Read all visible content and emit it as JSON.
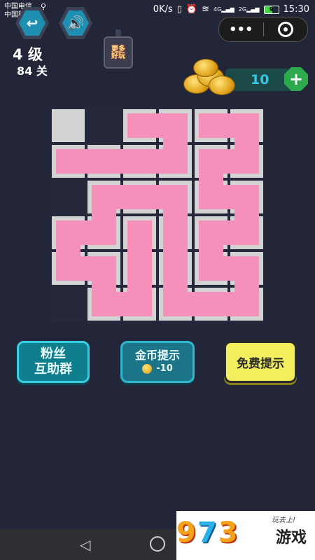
{
  "status_bar": {
    "carrier_1": "中国电信",
    "carrier_2": "中国移动",
    "network_speed": "0K/s",
    "signal_1_label": "4G",
    "signal_2_label": "2G",
    "battery_level": "9",
    "time": "15:30"
  },
  "header": {
    "back_icon": "back-arrow-icon",
    "sound_icon": "speaker-icon",
    "level_label": "4 级",
    "stage_label": "84 关",
    "promo_text_1": "更多",
    "promo_text_2": "好玩",
    "coin_count": "10",
    "menu_dots": "•••"
  },
  "board": {
    "rows": 6,
    "cols": 6,
    "path_color": "#f590bb",
    "cell_color": "#d3d3d3",
    "grid_color": "#25273a",
    "blocked_cell": [
      0,
      0
    ],
    "cells": [
      [
        0,
        0,
        1,
        1,
        1,
        1
      ],
      [
        1,
        1,
        1,
        1,
        1,
        1
      ],
      [
        0,
        1,
        1,
        1,
        1,
        1
      ],
      [
        1,
        1,
        1,
        1,
        1,
        1
      ],
      [
        1,
        1,
        1,
        1,
        1,
        1
      ],
      [
        0,
        1,
        1,
        1,
        1,
        1
      ]
    ],
    "path": [
      [
        1,
        0
      ],
      [
        1,
        1
      ],
      [
        1,
        2
      ],
      [
        1,
        3
      ],
      [
        0,
        3
      ],
      [
        0,
        2
      ],
      [
        0,
        4
      ],
      [
        0,
        5
      ],
      [
        1,
        5
      ],
      [
        1,
        4
      ],
      [
        2,
        4
      ],
      [
        2,
        5
      ],
      [
        3,
        5
      ],
      [
        3,
        4
      ],
      [
        4,
        4
      ],
      [
        4,
        5
      ],
      [
        5,
        5
      ],
      [
        5,
        4
      ],
      [
        5,
        3
      ],
      [
        4,
        3
      ],
      [
        3,
        3
      ],
      [
        2,
        3
      ],
      [
        2,
        2
      ],
      [
        2,
        1
      ],
      [
        3,
        1
      ],
      [
        3,
        0
      ],
      [
        4,
        0
      ],
      [
        4,
        1
      ],
      [
        5,
        1
      ],
      [
        5,
        2
      ],
      [
        4,
        2
      ],
      [
        3,
        2
      ]
    ]
  },
  "buttons": {
    "fans_line_1": "粉丝",
    "fans_line_2": "互助群",
    "coin_hint_title": "金币提示",
    "coin_hint_cost": "-10",
    "free_hint": "免费提示"
  },
  "watermark": {
    "digits": [
      "9",
      "7",
      "3"
    ],
    "text": "游戏",
    "slogan": "玩去上!"
  }
}
